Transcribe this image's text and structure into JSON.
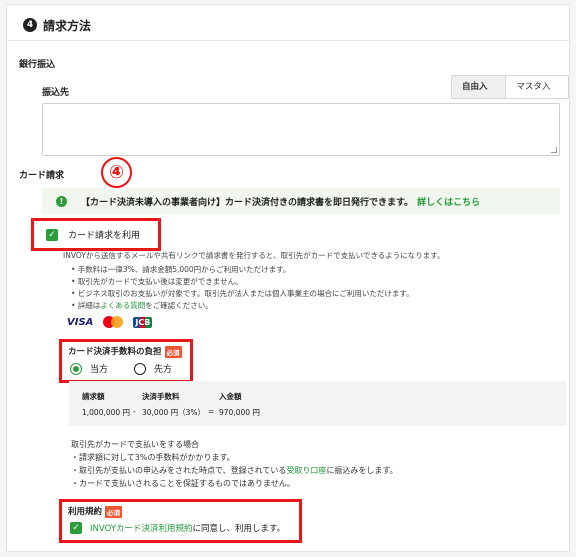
{
  "header": {
    "step_number": "4",
    "title": "請求方法"
  },
  "bank": {
    "section_label": "銀行振込",
    "field_label": "振込先",
    "tabs": [
      {
        "label": "自由入力"
      },
      {
        "label": "マスタ入力"
      }
    ],
    "textarea_value": ""
  },
  "card": {
    "section_label": "カード請求",
    "annotation_marker": "④",
    "notice_text": "【カード決済未導入の事業者向け】カード決済付きの請求書を即日発行できます。",
    "notice_link": "詳しくはこちら",
    "enable_label": "カード請求を利用",
    "description": "INVOYから送信するメールや共有リンクで請求書を発行すると、取引先がカードで支払いできるようになります。",
    "bullets": [
      "手数料は一律3%、請求金額5,000円からご利用いただけます。",
      "取引先がカードで支払い後は変更ができません。",
      "ビジネス取引のお支払いが対象です。取引先が法人または個人事業主の場合にご利用いただけます。"
    ],
    "faq_prefix": "詳細は",
    "faq_link": "よくある質問",
    "faq_suffix": "をご確認ください。",
    "brands": {
      "visa": "VISA",
      "jcb": "JCB"
    },
    "fee_burden": {
      "label": "カード決済手数料の負担",
      "required": "必須",
      "options": [
        {
          "label": "当方"
        },
        {
          "label": "先方"
        }
      ]
    },
    "calc": {
      "headers": [
        "請求額",
        "決済手数料",
        "入金額"
      ],
      "invoice_amount": "1,000,000 円",
      "minus": "-",
      "fee": "30,000 円（3%）",
      "equals": "=",
      "deposit": "970,000 円"
    },
    "notes": {
      "heading": "取引先がカードで支払いをする場合",
      "line1": "・請求額に対して3%の手数料がかかります。",
      "line2_prefix": "・取引先が支払いの申込みをされた時点で、登録されている",
      "line2_link": "受取り口座",
      "line2_suffix": "に振込みをします。",
      "line3": "・カードで支払いされることを保証するものではありません。"
    },
    "terms": {
      "label": "利用規約",
      "required": "必須",
      "link": "INVOYカード決済利用規約",
      "suffix": "に同意し、利用します。"
    }
  },
  "colors": {
    "accent": "#2a9d3a",
    "highlight": "#e81818"
  }
}
